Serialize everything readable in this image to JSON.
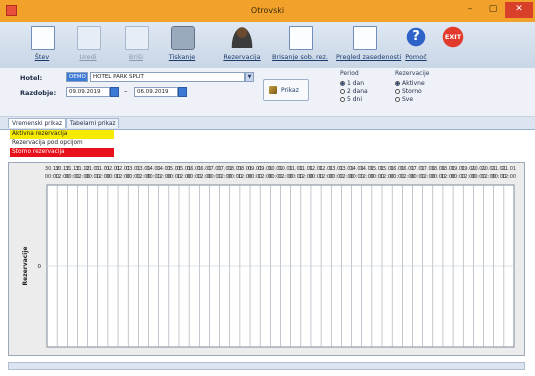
{
  "window": {
    "title": "Otrovski",
    "min_label": "–",
    "max_label": "▢",
    "close_label": "✕"
  },
  "toolbar": {
    "items": [
      {
        "label": "Štev",
        "icon": "new-document-icon",
        "enabled": true
      },
      {
        "label": "Uredi",
        "icon": "edit-document-icon",
        "enabled": false
      },
      {
        "label": "Briši",
        "icon": "delete-document-icon",
        "enabled": false
      },
      {
        "label": "Tiskanje",
        "icon": "printer-icon",
        "enabled": true
      },
      {
        "label": "Rezervacija",
        "icon": "guest-icon",
        "enabled": true
      },
      {
        "label": "Brisanje sob. rez.",
        "icon": "room-document-icon",
        "enabled": true
      },
      {
        "label": "Pregled zasedenosti",
        "icon": "overview-icon",
        "enabled": true
      },
      {
        "label": "Pomoč",
        "icon": "help-icon",
        "enabled": true,
        "glyph": "?"
      },
      {
        "label": "",
        "icon": "exit-icon",
        "enabled": true,
        "glyph": "EXIT"
      }
    ]
  },
  "filter": {
    "hotel_label": "Hotel:",
    "hotel_code": "DEMO",
    "hotel_name": "HOTEL PARK SPLIT",
    "period_label": "Razdobje:",
    "date_from": "09.09.2019",
    "date_to": "06.09.2019",
    "date_separator": "–",
    "show_button_label": "Prikaz",
    "period_group": {
      "title": "Period",
      "options": [
        "1 dan",
        "2 dana",
        "5 dni"
      ],
      "selected": 0
    },
    "reservation_group": {
      "title": "Rezervacije",
      "options": [
        "Aktivne",
        "Storno",
        "Sve"
      ],
      "selected": 0
    }
  },
  "tabs": [
    {
      "label": "Vremenski prikaz",
      "active": true
    },
    {
      "label": "Tabelarni prikaz",
      "active": false
    }
  ],
  "legend": [
    {
      "label": "Aktivna rezervacija",
      "color": "#f5ea00"
    },
    {
      "label": "Rezervacija pod opcijom",
      "color": "#ffffff"
    },
    {
      "label": "Storno rezervacija",
      "color": "#e8101a"
    }
  ],
  "chart_data": {
    "type": "heatmap",
    "title": "",
    "ylabel": "Rezervacije",
    "yticks": [
      "0"
    ],
    "x_top_labels": [
      "30.12",
      "30.12",
      "31.12",
      "31.12",
      "01.01",
      "01.01",
      "02.01",
      "02.01",
      "03.01",
      "03.01",
      "04.01",
      "04.01",
      "05.01",
      "05.01",
      "06.01",
      "06.01",
      "07.01",
      "07.01",
      "08.01",
      "08.01",
      "09.01",
      "09.01",
      "10.01",
      "10.01",
      "11.01",
      "11.01",
      "12.01",
      "12.01",
      "13.01",
      "13.01",
      "14.01",
      "14.01",
      "15.01",
      "15.01",
      "16.01",
      "16.01",
      "17.01",
      "17.01",
      "18.01",
      "18.01",
      "19.01",
      "19.01",
      "20.01",
      "20.01",
      "21.01",
      "21.01"
    ],
    "x_bottom_labels": [
      "00:00",
      "12:00",
      "00:00",
      "12:00",
      "00:00",
      "12:00",
      "00:00",
      "12:00",
      "00:00",
      "12:00",
      "00:00",
      "12:00",
      "00:00",
      "12:00",
      "00:00",
      "12:00",
      "00:00",
      "12:00",
      "00:00",
      "12:00",
      "00:00",
      "12:00",
      "00:00",
      "12:00",
      "00:00",
      "12:00",
      "00:00",
      "12:00",
      "00:00",
      "12:00",
      "00:00",
      "12:00",
      "00:00",
      "12:00",
      "00:00",
      "12:00",
      "00:00",
      "12:00",
      "00:00",
      "12:00",
      "00:00",
      "12:00",
      "00:00",
      "12:00",
      "00:00",
      "12:00"
    ],
    "grid": true,
    "grid_color": "#9aa4b0",
    "bars": []
  },
  "status": {
    "text": ""
  }
}
